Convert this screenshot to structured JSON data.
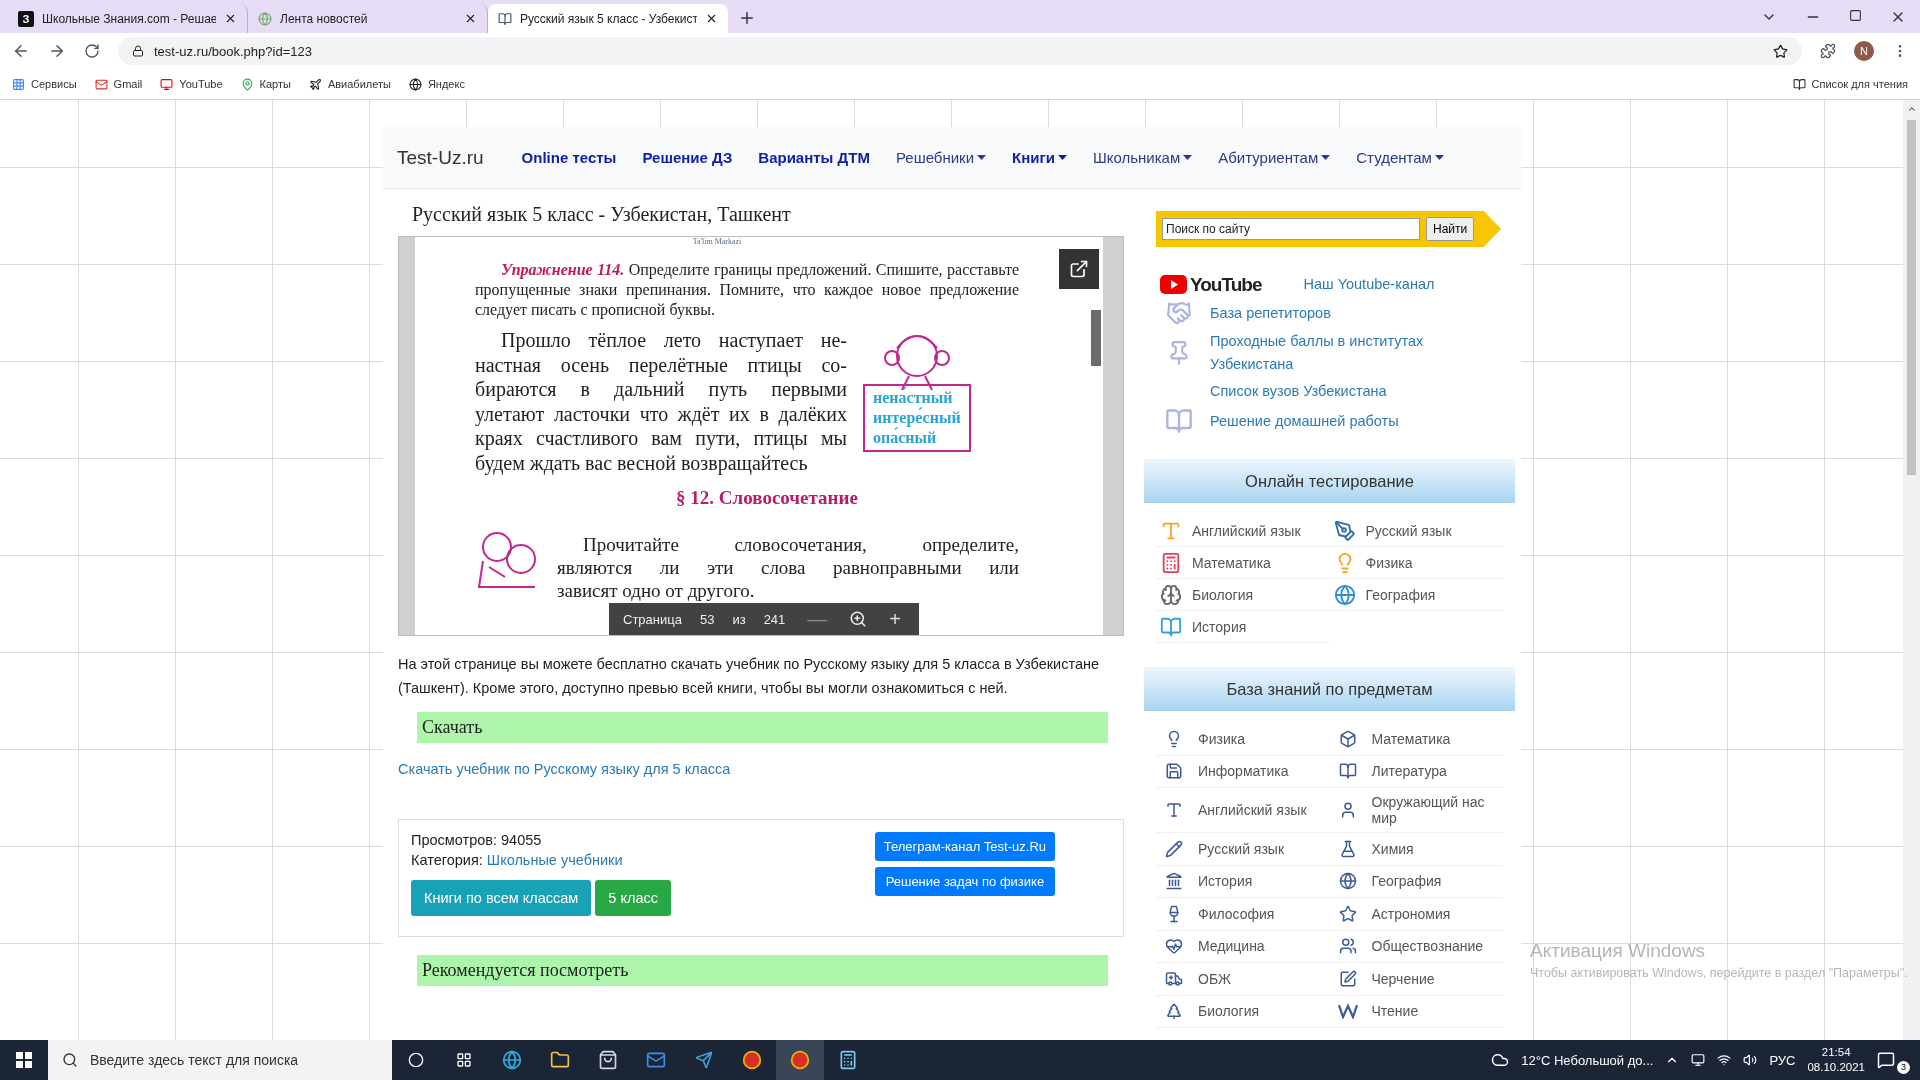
{
  "browser": {
    "tabs": [
      {
        "title": "Школьные Знания.com - Решае",
        "favicon_text": "З",
        "selected": false
      },
      {
        "title": "Лента новостей",
        "selected": false
      },
      {
        "title": "Русский язык 5 класс - Узбекист",
        "selected": true
      }
    ],
    "url": "test-uz.ru/book.php?id=123",
    "profile_initial": "N",
    "bookmarks": [
      "Сервисы",
      "Gmail",
      "YouTube",
      "Карты",
      "Авиабилеты",
      "Яндекс"
    ],
    "reading_list": "Список для чтения"
  },
  "site": {
    "brand": "Test-Uz.ru",
    "nav": [
      {
        "label": "Online тесты",
        "bold": true,
        "dropdown": false
      },
      {
        "label": "Решение ДЗ",
        "bold": true,
        "dropdown": false
      },
      {
        "label": "Варианты ДТМ",
        "bold": true,
        "dropdown": false
      },
      {
        "label": "Решебники",
        "bold": false,
        "dropdown": true
      },
      {
        "label": "Книги",
        "bold": true,
        "dropdown": true
      },
      {
        "label": "Школьникам",
        "bold": false,
        "dropdown": true
      },
      {
        "label": "Абитуриентам",
        "bold": false,
        "dropdown": true
      },
      {
        "label": "Студентам",
        "bold": false,
        "dropdown": true
      }
    ]
  },
  "main": {
    "title": "Русский язык 5 класс - Узбекистан, Ташкент",
    "viewer": {
      "page": {
        "header_fragment": "Ta'lim Markazi",
        "exercise_label": "Упражнение 114.",
        "exercise_text": "Определите границы предложений. Спишите, расставьте пропущенные знаки препинания. Помните, что каждое новое предложение следует писать с прописной буквы.",
        "passage_lines": [
          "Прошло тёплое лето наступает не-",
          "настная осень перелётные птицы со-",
          "бираются в дальний путь первыми",
          "улетают ласточки что ждёт их в далёких",
          "краях счастливого вам пути, птицы мы",
          "будем ждать вас весной возвращайтесь"
        ],
        "sign_words": [
          "нена́стный",
          "интере́сный",
          "опа́сный"
        ],
        "section_heading": "§ 12. Словосочетание",
        "task_lines": [
          "Прочитайте словосочетания, определите,",
          "являются ли эти слова равноправными или",
          "зависят одно от другого."
        ]
      },
      "toolbar": {
        "page_label": "Страница",
        "page": "53",
        "of_label": "из",
        "total": "241",
        "zoom_out": "—",
        "zoom_in": "+"
      }
    },
    "description": "На этой странице вы можете бесплатно скачать учебник по Русскому языку для 5 класса в Узбекистане (Ташкент). Кроме этого, доступно превью всей книги, чтобы вы могли ознакомиться с ней.",
    "download_heading": "Скачать",
    "download_link": "Скачать учебник по Русскому языку для 5 класса",
    "info": {
      "views": "Просмотров: 94055",
      "category_label": "Категория:",
      "category": "Школьные учебники",
      "buttons": [
        {
          "label": "Книги по всем классам",
          "kind": "info"
        },
        {
          "label": "5 класс",
          "kind": "success"
        }
      ],
      "side_buttons": [
        "Телеграм-канал Test-uz.Ru",
        "Решение задач по физике"
      ]
    },
    "recommend_heading": "Рекомендуется посмотреть"
  },
  "sidebar": {
    "search": {
      "placeholder": "Поиск по сайту",
      "button": "Найти"
    },
    "youtube_logo": "YouTube",
    "links": [
      "Наш Youtube-канал",
      "База репетиторов",
      "Проходные баллы в институтах Узбекистана",
      "Список вузов Узбекистана",
      "Решение домашней работы"
    ],
    "testing": {
      "title": "Онлайн тестирование",
      "items": [
        "Английский язык",
        "Русский язык",
        "Математика",
        "Физика",
        "Биология",
        "География",
        "История"
      ]
    },
    "knowledge": {
      "title": "База знаний по предметам",
      "items": [
        "Физика",
        "Математика",
        "Информатика",
        "Литература",
        "Английский язык",
        "Окружающий нас мир",
        "Русский язык",
        "Химия",
        "История",
        "География",
        "Философия",
        "Астрономия",
        "Медицина",
        "Обществознание",
        "ОБЖ",
        "Черчение",
        "Биология",
        "Чтение"
      ]
    }
  },
  "activation": {
    "title": "Активация Windows",
    "text": "Чтобы активировать Windows, перейдите в раздел \"Параметры\"."
  },
  "taskbar": {
    "search_placeholder": "Введите здесь текст для поиска",
    "weather": "12°C Небольшой до...",
    "language": "РУС",
    "time": "21:54",
    "date": "08.10.2021",
    "notifications": "3"
  }
}
